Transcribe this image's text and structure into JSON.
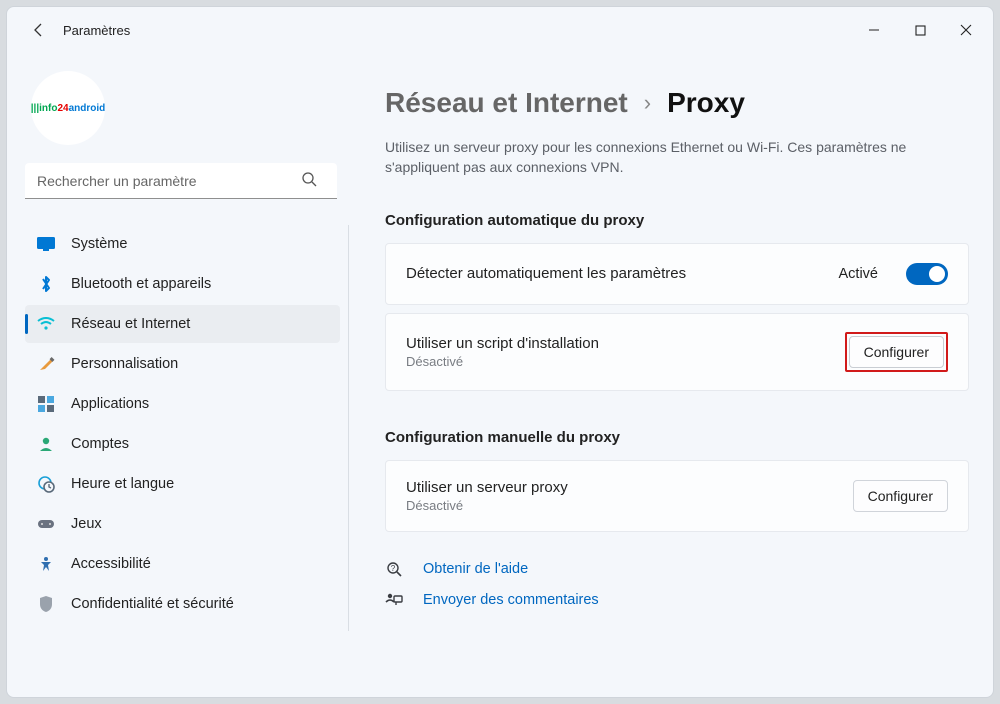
{
  "window": {
    "title": "Paramètres"
  },
  "search": {
    "placeholder": "Rechercher un paramètre"
  },
  "nav": {
    "items": [
      {
        "label": "Système"
      },
      {
        "label": "Bluetooth et appareils"
      },
      {
        "label": "Réseau et Internet"
      },
      {
        "label": "Personnalisation"
      },
      {
        "label": "Applications"
      },
      {
        "label": "Comptes"
      },
      {
        "label": "Heure et langue"
      },
      {
        "label": "Jeux"
      },
      {
        "label": "Accessibilité"
      },
      {
        "label": "Confidentialité et sécurité"
      }
    ]
  },
  "breadcrumb": {
    "parent": "Réseau et Internet",
    "current": "Proxy"
  },
  "description": "Utilisez un serveur proxy pour les connexions Ethernet ou Wi-Fi. Ces paramètres ne s'appliquent pas aux connexions VPN.",
  "sections": {
    "auto": {
      "title": "Configuration automatique du proxy",
      "detect": {
        "label": "Détecter automatiquement les paramètres",
        "status": "Activé"
      },
      "script": {
        "label": "Utiliser un script d'installation",
        "sub": "Désactivé",
        "button": "Configurer"
      }
    },
    "manual": {
      "title": "Configuration manuelle du proxy",
      "server": {
        "label": "Utiliser un serveur proxy",
        "sub": "Désactivé",
        "button": "Configurer"
      }
    }
  },
  "links": {
    "help": "Obtenir de l'aide",
    "feedback": "Envoyer des commentaires"
  }
}
